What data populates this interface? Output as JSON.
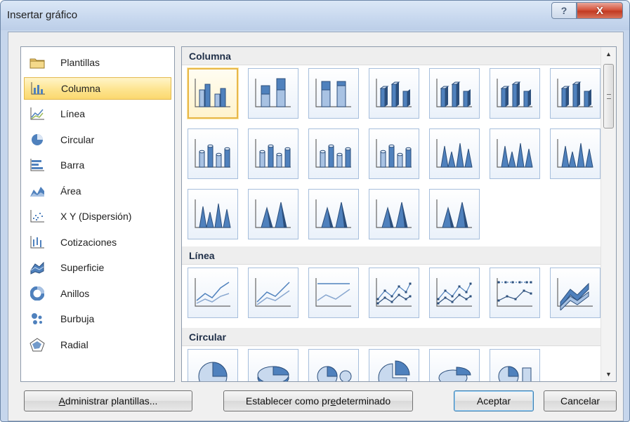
{
  "window": {
    "title": "Insertar gráfico",
    "help_label": "?",
    "close_label": "X"
  },
  "categories": [
    {
      "label": "Plantillas",
      "icon": "folder-icon"
    },
    {
      "label": "Columna",
      "icon": "column-chart-icon",
      "selected": true
    },
    {
      "label": "Línea",
      "icon": "line-chart-icon"
    },
    {
      "label": "Circular",
      "icon": "pie-chart-icon"
    },
    {
      "label": "Barra",
      "icon": "bar-chart-icon"
    },
    {
      "label": "Área",
      "icon": "area-chart-icon"
    },
    {
      "label": "X Y (Dispersión)",
      "icon": "scatter-chart-icon"
    },
    {
      "label": "Cotizaciones",
      "icon": "stock-chart-icon"
    },
    {
      "label": "Superficie",
      "icon": "surface-chart-icon"
    },
    {
      "label": "Anillos",
      "icon": "doughnut-chart-icon"
    },
    {
      "label": "Burbuja",
      "icon": "bubble-chart-icon"
    },
    {
      "label": "Radial",
      "icon": "radar-chart-icon"
    }
  ],
  "gallery": {
    "sections": [
      {
        "title": "Columna"
      },
      {
        "title": "Línea"
      },
      {
        "title": "Circular"
      }
    ],
    "column_thumbs": [
      "clustered-column",
      "stacked-column",
      "100-stacked-column",
      "3d-clustered-column",
      "3d-stacked-column",
      "3d-100-stacked-column",
      "3d-column",
      "clustered-cylinder",
      "stacked-cylinder",
      "100-stacked-cylinder",
      "3d-cylinder",
      "clustered-cone",
      "stacked-cone",
      "100-stacked-cone",
      "3d-cone",
      "clustered-pyramid",
      "stacked-pyramid",
      "100-stacked-pyramid",
      "3d-pyramid"
    ],
    "line_thumbs": [
      "line",
      "stacked-line",
      "100-stacked-line",
      "line-markers",
      "stacked-line-markers",
      "100-stacked-line-markers",
      "3d-line"
    ],
    "pie_thumbs": [
      "pie",
      "3d-pie",
      "pie-of-pie",
      "exploded-pie",
      "3d-exploded-pie",
      "bar-of-pie"
    ]
  },
  "buttons": {
    "manage_pre": "",
    "manage_u": "A",
    "manage_post": "dministrar plantillas...",
    "default_pre": "Establecer como pr",
    "default_u": "e",
    "default_post": "determinado",
    "ok": "Aceptar",
    "cancel": "Cancelar"
  },
  "colors": {
    "accent_selected": "#fde48f",
    "chart_blue": "#4f81bd"
  }
}
